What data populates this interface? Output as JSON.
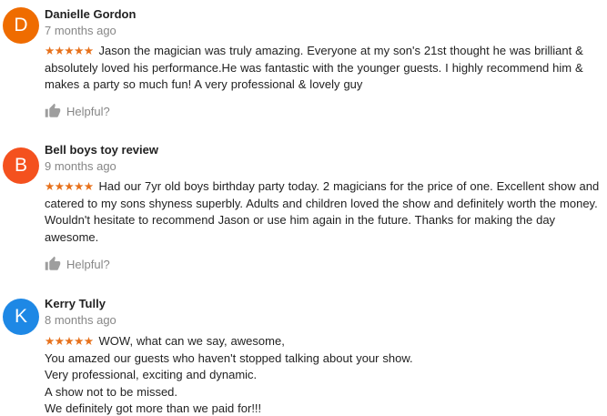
{
  "reviews": [
    {
      "initial": "D",
      "avatar_color": "#ef6c00",
      "name": "Danielle Gordon",
      "date": "7 months ago",
      "stars": "★★★★★",
      "text": "Jason the magician was truly amazing. Everyone at my son's 21st thought he was brilliant & absolutely loved his performance.He was fantastic with the younger guests. I highly recommend him & makes a party so much fun! A very professional & lovely guy",
      "helpful": "Helpful?"
    },
    {
      "initial": "B",
      "avatar_color": "#f4511e",
      "name": "Bell boys toy review",
      "date": "9 months ago",
      "stars": "★★★★★",
      "text": "Had our 7yr old boys birthday party today. 2 magicians for the price of one. Excellent show and catered to my sons shyness superbly. Adults and children loved the show and definitely worth the money. Wouldn't hesitate to recommend Jason or use him again in the future. Thanks for making the day awesome.",
      "helpful": "Helpful?"
    },
    {
      "initial": "K",
      "avatar_color": "#1e88e5",
      "name": "Kerry Tully",
      "date": "8 months ago",
      "stars": "★★★★★",
      "lines": [
        "WOW, what can we say, awesome,",
        "You amazed our guests who haven't stopped talking about your show.",
        "Very professional, exciting and dynamic.",
        "A show not to be missed.",
        "We definitely got more than we paid for!!!"
      ]
    }
  ]
}
